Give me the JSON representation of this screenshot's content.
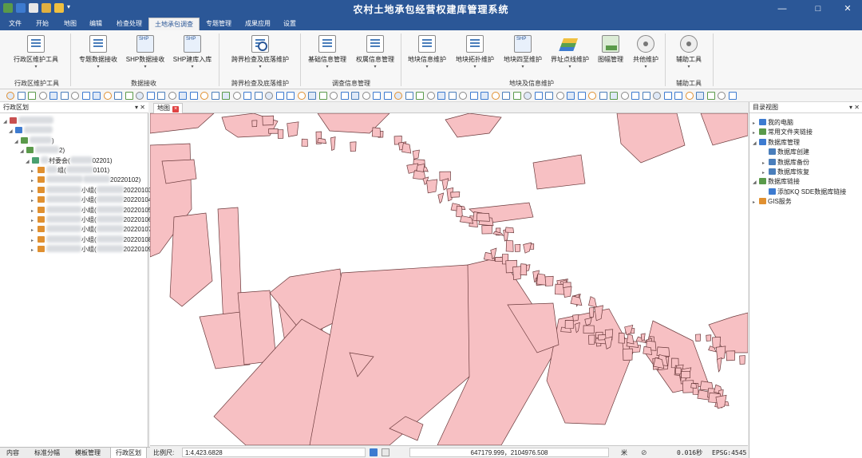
{
  "app": {
    "title": "农村土地承包经营权建库管理系统"
  },
  "window": {
    "minimize": "—",
    "maximize": "□",
    "close": "✕"
  },
  "menu": [
    {
      "label": "文件"
    },
    {
      "label": "开始"
    },
    {
      "label": "地图"
    },
    {
      "label": "编辑"
    },
    {
      "label": "检查处理"
    },
    {
      "label": "土地承包调查"
    },
    {
      "label": "专题管理"
    },
    {
      "label": "成果应用"
    },
    {
      "label": "设置"
    }
  ],
  "ribbon": {
    "buttons": [
      {
        "label": "行政区维护工具",
        "icon": "grid-icon"
      },
      {
        "label": "专题数据接收",
        "icon": "import-icon"
      },
      {
        "label": "SHP数据接收",
        "icon": "shp-icon"
      },
      {
        "label": "SHP建库入库",
        "icon": "shp-db-icon"
      },
      {
        "label": "跨界检查及底落维护",
        "icon": "check-icon"
      },
      {
        "label": "基础信息管理",
        "icon": "list-icon"
      },
      {
        "label": "权属信息管理",
        "icon": "list-icon"
      },
      {
        "label": "地块信息维护",
        "icon": "list-icon"
      },
      {
        "label": "地块拓扑维护",
        "icon": "topology-icon"
      },
      {
        "label": "地块四至维护",
        "icon": "shp-icon"
      },
      {
        "label": "界址点线维护",
        "icon": "layers-icon"
      },
      {
        "label": "图幅管理",
        "icon": "image-icon"
      },
      {
        "label": "共他维护",
        "icon": "gear-icon"
      },
      {
        "label": "辅助工具",
        "icon": "gear-icon"
      }
    ],
    "groups": [
      {
        "label": "行政区维护工具"
      },
      {
        "label": "数据接收"
      },
      {
        "label": "跨界检查及底落维护"
      },
      {
        "label": "调查信息管理"
      },
      {
        "label": "地块及信息维护"
      },
      {
        "label": "辅助工具"
      }
    ]
  },
  "left_panel": {
    "title": "行政区划",
    "header_controls": "▾ ✕",
    "tree": [
      {
        "label": "",
        "level": 0
      },
      {
        "label": "",
        "level": 1
      },
      {
        "label": ")",
        "level": 2
      },
      {
        "label": "2)",
        "level": 3
      },
      {
        "label": "村委会(",
        "suffix": "02201)",
        "level": 4
      },
      {
        "label": "组(",
        "suffix": "0101)",
        "level": 5
      },
      {
        "label": "",
        "suffix": "20220102)",
        "level": 5
      },
      {
        "label": "小组(",
        "suffix": "20220103)",
        "level": 5
      },
      {
        "label": "小组(",
        "suffix": "20220104)",
        "level": 5
      },
      {
        "label": "小组(",
        "suffix": "20220105)",
        "level": 5
      },
      {
        "label": "小组(",
        "suffix": "20220106)",
        "level": 5
      },
      {
        "label": "小组(",
        "suffix": "20220107)",
        "level": 5
      },
      {
        "label": "小组(",
        "suffix": "20220108)",
        "level": 5
      },
      {
        "label": "小组(",
        "suffix": "20220109)",
        "level": 5
      }
    ],
    "bottom_tabs": [
      {
        "label": "内容"
      },
      {
        "label": "标准分幅"
      },
      {
        "label": "模板管理"
      },
      {
        "label": "行政区划"
      }
    ]
  },
  "map": {
    "tab_label": "地图",
    "tab_close": "×",
    "parcel_fill": "#f7c0c3",
    "parcel_stroke": "#6b3a3c"
  },
  "right_panel": {
    "title": "目录视图",
    "header_controls": "▾ ✕",
    "tree": [
      {
        "label": "我的电脑"
      },
      {
        "label": "常用文件夹链接"
      },
      {
        "label": "数据库管理"
      },
      {
        "label": "数据库创建"
      },
      {
        "label": "数据库备份"
      },
      {
        "label": "数据库恢复"
      },
      {
        "label": "数据库链接"
      },
      {
        "label": "添加KQ SDE数据库链接"
      },
      {
        "label": "GIS服务"
      }
    ]
  },
  "statusbar": {
    "scale_label": "比例尺:",
    "scale_value": "1:4,423.6828",
    "coordinates": "647179.999，2104976.508",
    "unit": "米",
    "time": "0.016秒",
    "epsg": "EPSG:4545"
  },
  "colors": {
    "title_bar": "#2b5797",
    "accent": "#2b5797"
  }
}
